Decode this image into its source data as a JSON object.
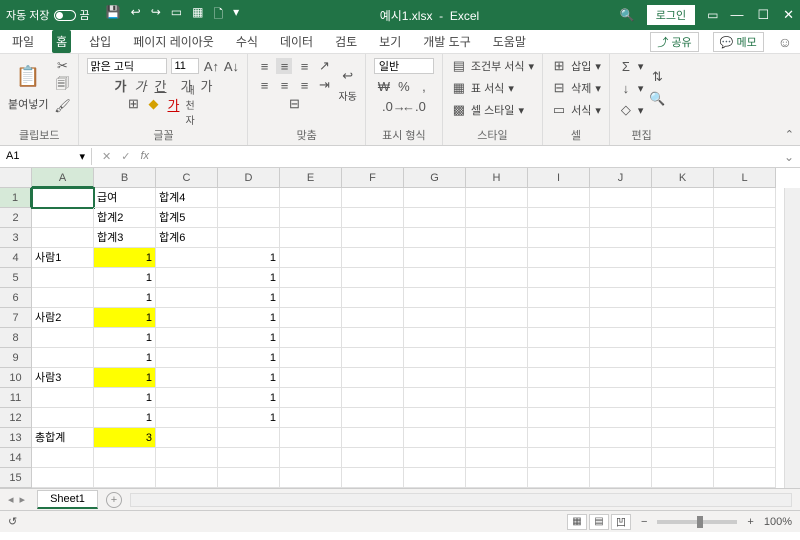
{
  "title": {
    "autosave_label": "자동 저장",
    "autosave_state": "끔",
    "filename": "예시1.xlsx",
    "appname": "Excel",
    "login": "로그인"
  },
  "tabs": {
    "items": [
      "파일",
      "홈",
      "삽입",
      "페이지 레이아웃",
      "수식",
      "데이터",
      "검토",
      "보기",
      "개발 도구",
      "도움말"
    ],
    "share": "공유",
    "memo": "메모"
  },
  "ribbon": {
    "clipboard": {
      "label": "클립보드",
      "paste": "붙여넣기"
    },
    "font": {
      "label": "글꼴",
      "name": "맑은 고딕",
      "size": "11",
      "bold": "가",
      "italic": "가",
      "underline": "간",
      "ruby": "가",
      "ruby2": "가"
    },
    "align": {
      "label": "맞춤",
      "wrap": "자동"
    },
    "number": {
      "label": "표시 형식",
      "format": "일반"
    },
    "styles": {
      "label": "스타일",
      "cond": "조건부 서식",
      "table": "표 서식",
      "cell": "셀 스타일"
    },
    "cells": {
      "label": "셀",
      "insert": "삽입",
      "delete": "삭제",
      "format": "서식"
    },
    "edit": {
      "label": "편집"
    }
  },
  "namebox": {
    "ref": "A1"
  },
  "columns": [
    "A",
    "B",
    "C",
    "D",
    "E",
    "F",
    "G",
    "H",
    "I",
    "J",
    "K",
    "L"
  ],
  "rows": [
    "1",
    "2",
    "3",
    "4",
    "5",
    "6",
    "7",
    "8",
    "9",
    "10",
    "11",
    "12",
    "13",
    "14",
    "15"
  ],
  "cells": {
    "B1": "급여",
    "C1": "합계4",
    "B2": "합계2",
    "C2": "합계5",
    "B3": "합계3",
    "C3": "합계6",
    "A4": "사람1",
    "B4": "1",
    "D4": "1",
    "B5": "1",
    "D5": "1",
    "B6": "1",
    "D6": "1",
    "A7": "사람2",
    "B7": "1",
    "D7": "1",
    "B8": "1",
    "D8": "1",
    "B9": "1",
    "D9": "1",
    "A10": "사람3",
    "B10": "1",
    "D10": "1",
    "B11": "1",
    "D11": "1",
    "B12": "1",
    "D12": "1",
    "A13": "총합계",
    "B13": "3"
  },
  "yellow_cells": [
    "B4",
    "B7",
    "B10",
    "B13"
  ],
  "sheet": {
    "name": "Sheet1"
  },
  "status": {
    "ready_icon": "↺",
    "zoom": "100%"
  }
}
